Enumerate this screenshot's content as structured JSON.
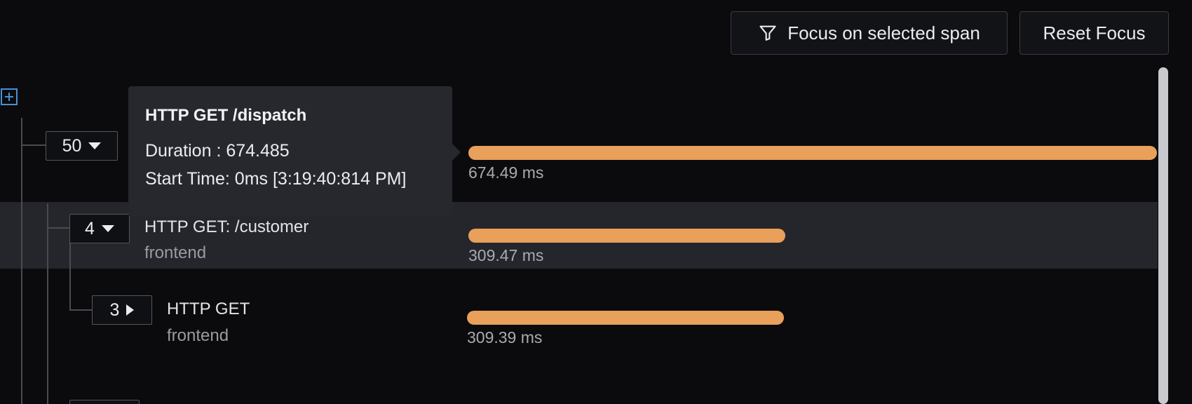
{
  "toolbar": {
    "focus_label": "Focus on selected span",
    "reset_label": "Reset Focus",
    "focus_icon": "filter-icon"
  },
  "tree": {
    "expand_icon": "plus-square-icon",
    "rows": [
      {
        "count": "50",
        "expanded": true,
        "name": "HTTP GET /dispatch",
        "service": "",
        "duration": "674.49 ms",
        "bar_fraction": 1.0
      },
      {
        "count": "4",
        "expanded": true,
        "name": "HTTP GET: /customer",
        "service": "frontend",
        "duration": "309.47 ms",
        "bar_fraction": 0.46
      },
      {
        "count": "3",
        "expanded": false,
        "name": "HTTP GET",
        "service": "frontend",
        "duration": "309.39 ms",
        "bar_fraction": 0.46
      }
    ]
  },
  "tooltip": {
    "title": "HTTP GET /dispatch",
    "duration": "Duration : 674.485",
    "start_time": "Start Time: 0ms [3:19:40:814 PM]"
  },
  "colors": {
    "bar": "#e8a05a",
    "accent": "#4a8fd8",
    "background": "#0b0b0e"
  }
}
